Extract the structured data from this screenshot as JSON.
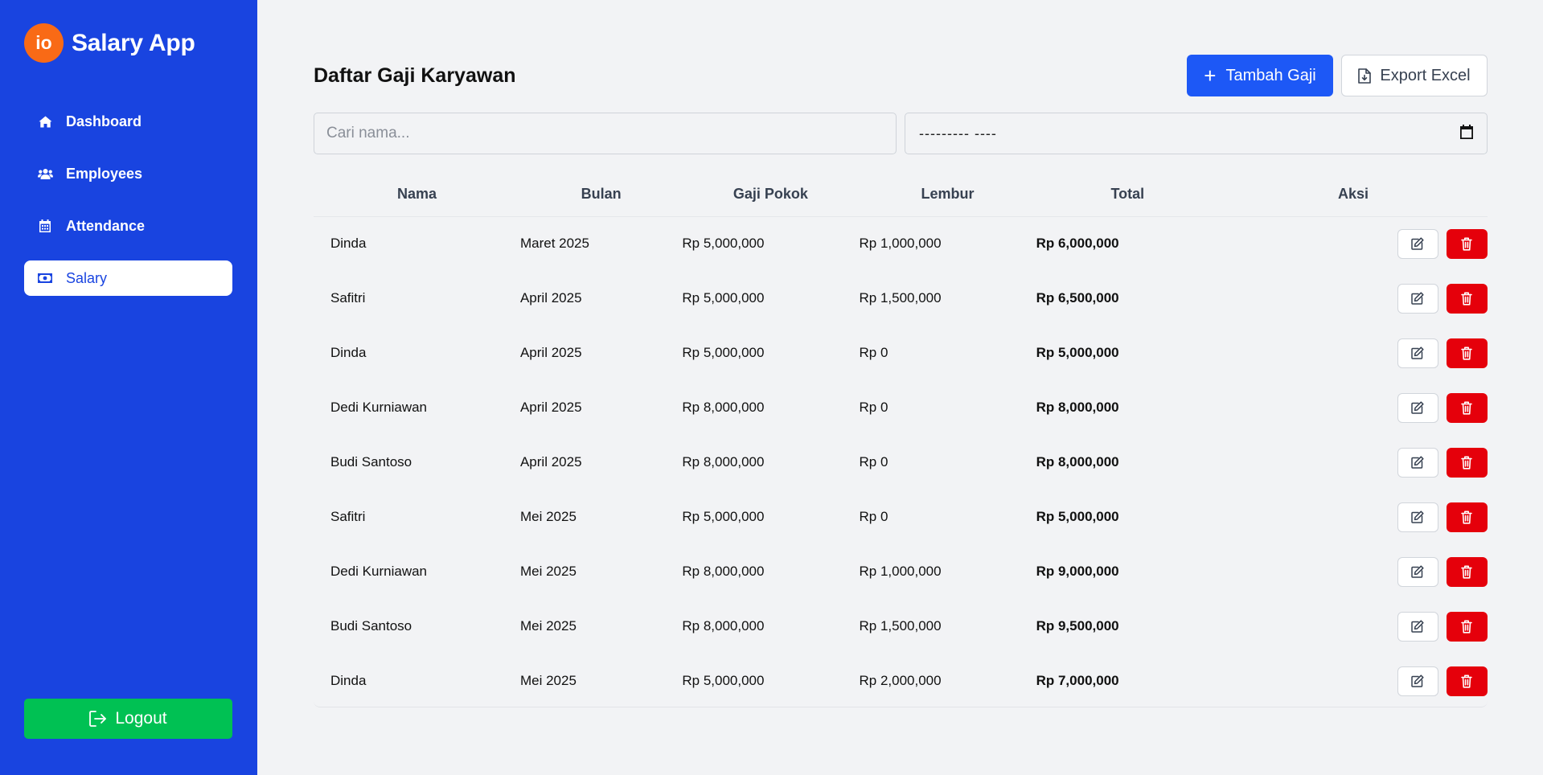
{
  "app": {
    "logo_text": "io",
    "name": "Salary App"
  },
  "nav": {
    "items": [
      {
        "label": "Dashboard",
        "icon": "home-icon"
      },
      {
        "label": "Employees",
        "icon": "users-icon"
      },
      {
        "label": "Attendance",
        "icon": "calendar-icon"
      },
      {
        "label": "Salary",
        "icon": "money-bill-icon",
        "active": true
      }
    ],
    "logout_label": "Logout"
  },
  "page": {
    "title": "Daftar Gaji Karyawan",
    "add_button": "Tambah Gaji",
    "export_button": "Export Excel",
    "search_placeholder": "Cari nama...",
    "search_value": "",
    "month_value": "--------- ----"
  },
  "table": {
    "headers": [
      "Nama",
      "Bulan",
      "Gaji Pokok",
      "Lembur",
      "Total",
      "Aksi"
    ],
    "rows": [
      [
        "Dinda",
        "Maret 2025",
        "Rp 5,000,000",
        "Rp 1,000,000",
        "Rp 6,000,000"
      ],
      [
        "Safitri",
        "April 2025",
        "Rp 5,000,000",
        "Rp 1,500,000",
        "Rp 6,500,000"
      ],
      [
        "Dinda",
        "April 2025",
        "Rp 5,000,000",
        "Rp 0",
        "Rp 5,000,000"
      ],
      [
        "Dedi Kurniawan",
        "April 2025",
        "Rp 8,000,000",
        "Rp 0",
        "Rp 8,000,000"
      ],
      [
        "Budi Santoso",
        "April 2025",
        "Rp 8,000,000",
        "Rp 0",
        "Rp 8,000,000"
      ],
      [
        "Safitri",
        "Mei 2025",
        "Rp 5,000,000",
        "Rp 0",
        "Rp 5,000,000"
      ],
      [
        "Dedi Kurniawan",
        "Mei 2025",
        "Rp 8,000,000",
        "Rp 1,000,000",
        "Rp 9,000,000"
      ],
      [
        "Budi Santoso",
        "Mei 2025",
        "Rp 8,000,000",
        "Rp 1,500,000",
        "Rp 9,500,000"
      ],
      [
        "Dinda",
        "Mei 2025",
        "Rp 5,000,000",
        "Rp 2,000,000",
        "Rp 7,000,000"
      ]
    ]
  },
  "colors": {
    "sidebar": "#1944e0",
    "primary": "#1d58f6",
    "logo": "#f96a16",
    "logout": "#00c153",
    "danger": "#e5000b"
  }
}
